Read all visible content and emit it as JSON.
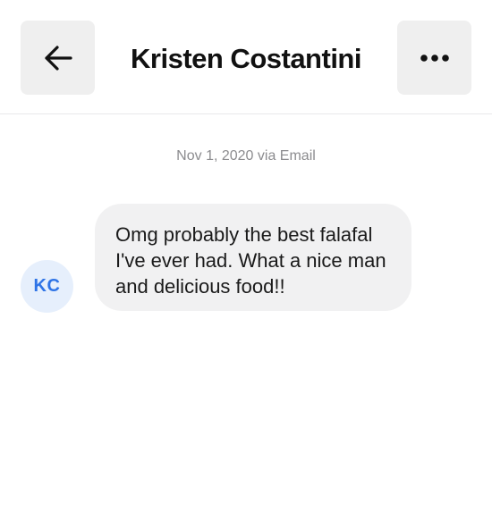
{
  "header": {
    "back_icon": "arrow-left-icon",
    "title": "Kristen Costantini",
    "more_icon": "more-horizontal-icon"
  },
  "conversation": {
    "date_label": "Nov 1, 2020 via Email",
    "messages": [
      {
        "sender_initials": "KC",
        "text": "Omg probably the best falafal I've ever had. What a nice man and delicious food!!"
      }
    ]
  },
  "colors": {
    "avatar_bg": "#e6effc",
    "avatar_text": "#2f74e6",
    "bubble_bg": "#f1f1f2",
    "icon_button_bg": "#efefef"
  }
}
